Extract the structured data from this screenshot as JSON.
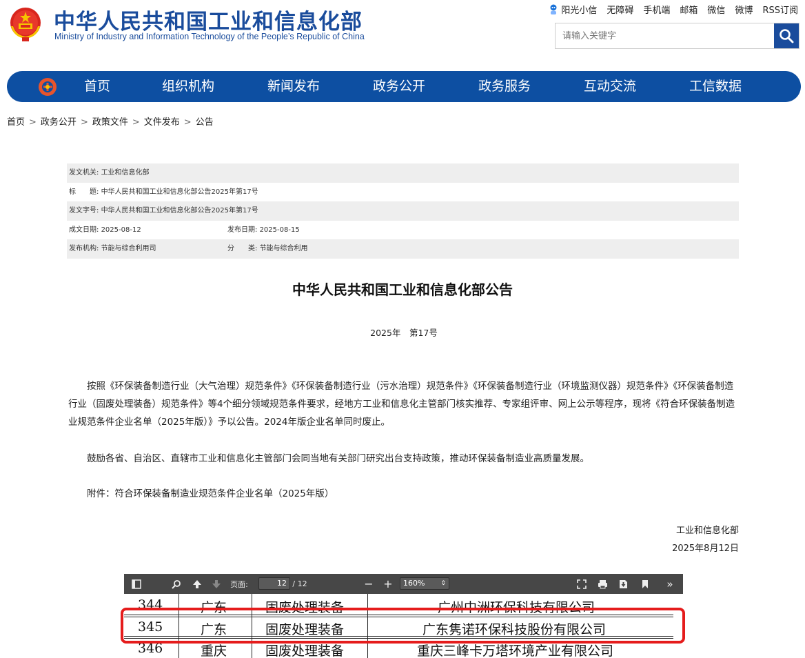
{
  "header": {
    "title": "中华人民共和国工业和信息化部",
    "subtitle": "Ministry of Industry and Information Technology of the People’s Republic of China",
    "toplinks": [
      "阳光小信",
      "无障碍",
      "手机端",
      "邮箱",
      "微信",
      "微博",
      "RSS订阅"
    ],
    "search_placeholder": "请输入关键字"
  },
  "nav": {
    "items": [
      "首页",
      "组织机构",
      "新闻发布",
      "政务公开",
      "政务服务",
      "互动交流",
      "工信数据"
    ]
  },
  "breadcrumb": [
    "首页",
    "政务公开",
    "政策文件",
    "文件发布",
    "公告"
  ],
  "meta": {
    "issuer_label": "发文机关:",
    "issuer": "工业和信息化部",
    "title_label": "标　　题:",
    "title": "中华人民共和国工业和信息化部公告2025年第17号",
    "docnum_label": "发文字号:",
    "docnum": "中华人民共和国工业和信息化部公告2025年第17号",
    "created_label": "成文日期:",
    "created": "2025-08-12",
    "published_label": "发布日期:",
    "published": "2025-08-15",
    "org_label": "发布机构:",
    "org": "节能与综合利用司",
    "category_label": "分　　类:",
    "category": "节能与综合利用"
  },
  "document": {
    "title": "中华人民共和国工业和信息化部公告",
    "number": "2025年　第17号",
    "para1": "　　按照《环保装备制造行业（大气治理）规范条件》《环保装备制造行业（污水治理）规范条件》《环保装备制造行业（环境监测仪器）规范条件》《环保装备制造行业（固废处理装备）规范条件》等4个细分领域规范条件要求，经地方工业和信息化主管部门核实推荐、专家组评审、网上公示等程序，现将《符合环保装备制造业规范条件企业名单（2025年版）》予以公告。2024年版企业名单同时废止。",
    "para2": "　　鼓励各省、自治区、直辖市工业和信息化主管部门会同当地有关部门研究出台支持政策，推动环保装备制造业高质量发展。",
    "para3": "　　附件：符合环保装备制造业规范条件企业名单（2025年版）",
    "sign_org": "工业和信息化部",
    "sign_date": "2025年8月12日"
  },
  "pdf_viewer": {
    "page_label": "页面:",
    "current_page": "12",
    "total_pages": "/ 12",
    "zoom": "160%",
    "rows": [
      {
        "no": "344",
        "province": "广东",
        "type": "固废处理装备",
        "company": "广州中洲环保科技有限公司"
      },
      {
        "no": "345",
        "province": "广东",
        "type": "固废处理装备",
        "company": "广东隽诺环保科技股份有限公司"
      },
      {
        "no": "346",
        "province": "重庆",
        "type": "固废处理装备",
        "company": "重庆三峰卡万塔环境产业有限公司"
      }
    ]
  },
  "colors": {
    "brand_blue": "#0d4fa2",
    "highlight_red": "#e51c1c",
    "toolbar_gray": "#474747"
  }
}
